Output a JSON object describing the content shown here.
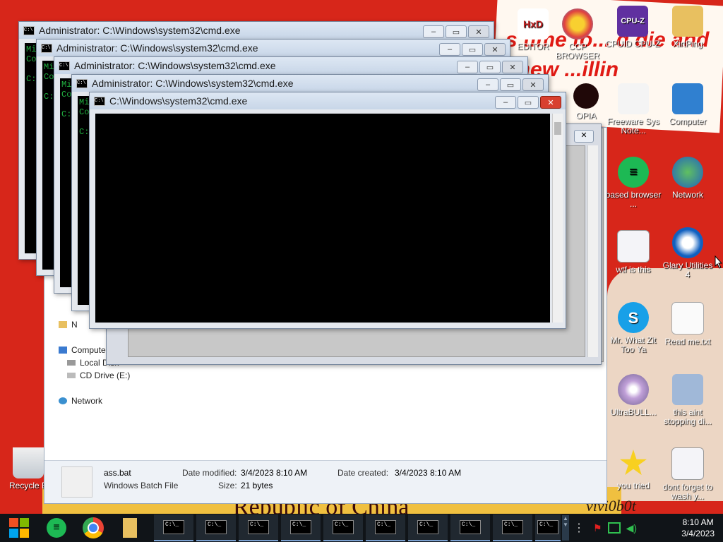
{
  "wallpaper": {
    "poster_text": "s time to... d die and chew ...illin",
    "bottom_text": "Republic of China",
    "mark": "vivi0b0t"
  },
  "desktop_icons": [
    {
      "name": "HxD EDITOR",
      "label": "EDITOR",
      "icon": "hxd-icon"
    },
    {
      "name": "CCP BROWSER",
      "label": "CCP BROWSER",
      "icon": "browser-icon"
    },
    {
      "name": "CPUID CPU-Z",
      "label": "CPUID CPU-Z",
      "icon": "cpuz-icon"
    },
    {
      "name": "XirtPing",
      "label": "XirtPing",
      "icon": "folder-user-icon"
    },
    {
      "name": "OPIA",
      "label": "OPIA",
      "icon": "red-disc-icon"
    },
    {
      "name": "Freeware Sys Note",
      "label": "Freeware Sys Note...",
      "icon": "note-icon"
    },
    {
      "name": "Computer",
      "label": "Computer",
      "icon": "computer-icon"
    },
    {
      "name": "based browser",
      "label": "based browser ...",
      "icon": "spotify-icon"
    },
    {
      "name": "Network",
      "label": "Network",
      "icon": "network-icon"
    },
    {
      "name": "wtf is this",
      "label": "wtf is this",
      "icon": "batch-file-icon"
    },
    {
      "name": "Glary Utilities 4",
      "label": "Glary Utilities 4",
      "icon": "glary-icon"
    },
    {
      "name": "Mr. What Zit Too Ya",
      "label": "Mr. What Zit Too Ya",
      "icon": "skype-icon"
    },
    {
      "name": "Read me.txt",
      "label": "Read me.txt",
      "icon": "text-file-icon"
    },
    {
      "name": "UltraBULL",
      "label": "UltraBULL...",
      "icon": "disc-icon"
    },
    {
      "name": "this aint stopping",
      "label": "this aint stopping di...",
      "icon": "monitor-icon"
    },
    {
      "name": "you tried",
      "label": "you tried",
      "icon": "star-icon"
    },
    {
      "name": "dont forget to wash",
      "label": "dont forget to wash y...",
      "icon": "batch-file-icon"
    },
    {
      "name": "Recycle Bin",
      "label": "Recycle B",
      "icon": "recycle-bin-icon"
    }
  ],
  "cmd_windows": [
    {
      "title": "Administrator: C:\\Windows\\system32\\cmd.exe",
      "lines": [
        "Mi",
        "Co",
        "",
        "C:"
      ]
    },
    {
      "title": "Administrator: C:\\Windows\\system32\\cmd.exe",
      "lines": [
        "Mi",
        "Co",
        "",
        "C:"
      ]
    },
    {
      "title": "Administrator: C:\\Windows\\system32\\cmd.exe",
      "lines": [
        "Mi",
        "Co",
        "",
        "C:"
      ]
    },
    {
      "title": "Administrator: C:\\Windows\\system32\\cmd.exe",
      "lines": [
        "Mi",
        "Co",
        "",
        "C:"
      ]
    },
    {
      "title": "C:\\Windows\\system32\\cmd.exe",
      "lines": []
    }
  ],
  "explorer": {
    "nav": [
      {
        "label": "N",
        "icon": "folder-icon"
      },
      {
        "label": "Computer",
        "icon": "computer-icon"
      },
      {
        "label": "Local Disk",
        "icon": "drive-icon"
      },
      {
        "label": "CD Drive (E:)",
        "icon": "cd-drive-icon"
      },
      {
        "label": "Network",
        "icon": "network-icon"
      }
    ],
    "details": {
      "file_name": "ass.bat",
      "file_type": "Windows Batch File",
      "modified_label": "Date modified:",
      "modified_value": "3/4/2023 8:10 AM",
      "size_label": "Size:",
      "size_value": "21 bytes",
      "created_label": "Date created:",
      "created_value": "3/4/2023 8:10 AM"
    }
  },
  "taskbar": {
    "start_icon": "windows-logo-icon",
    "pinned": [
      "notes-app-icon",
      "chrome-icon",
      "folder-icon"
    ],
    "cmd_buttons": [
      "C:\\_",
      "C:\\_",
      "C:\\_",
      "C:\\_",
      "C:\\_",
      "C:\\_",
      "C:\\_",
      "C:\\_",
      "C:\\_",
      "C:\\_"
    ],
    "tray_icons": [
      "flag-icon",
      "network-tray-icon",
      "volume-icon"
    ],
    "time": "8:10 AM",
    "date": "3/4/2023"
  },
  "colors": {
    "wallpaper_red": "#d7261a",
    "taskbar": "#101418",
    "console": "#000000",
    "close_red": "#d84030"
  }
}
